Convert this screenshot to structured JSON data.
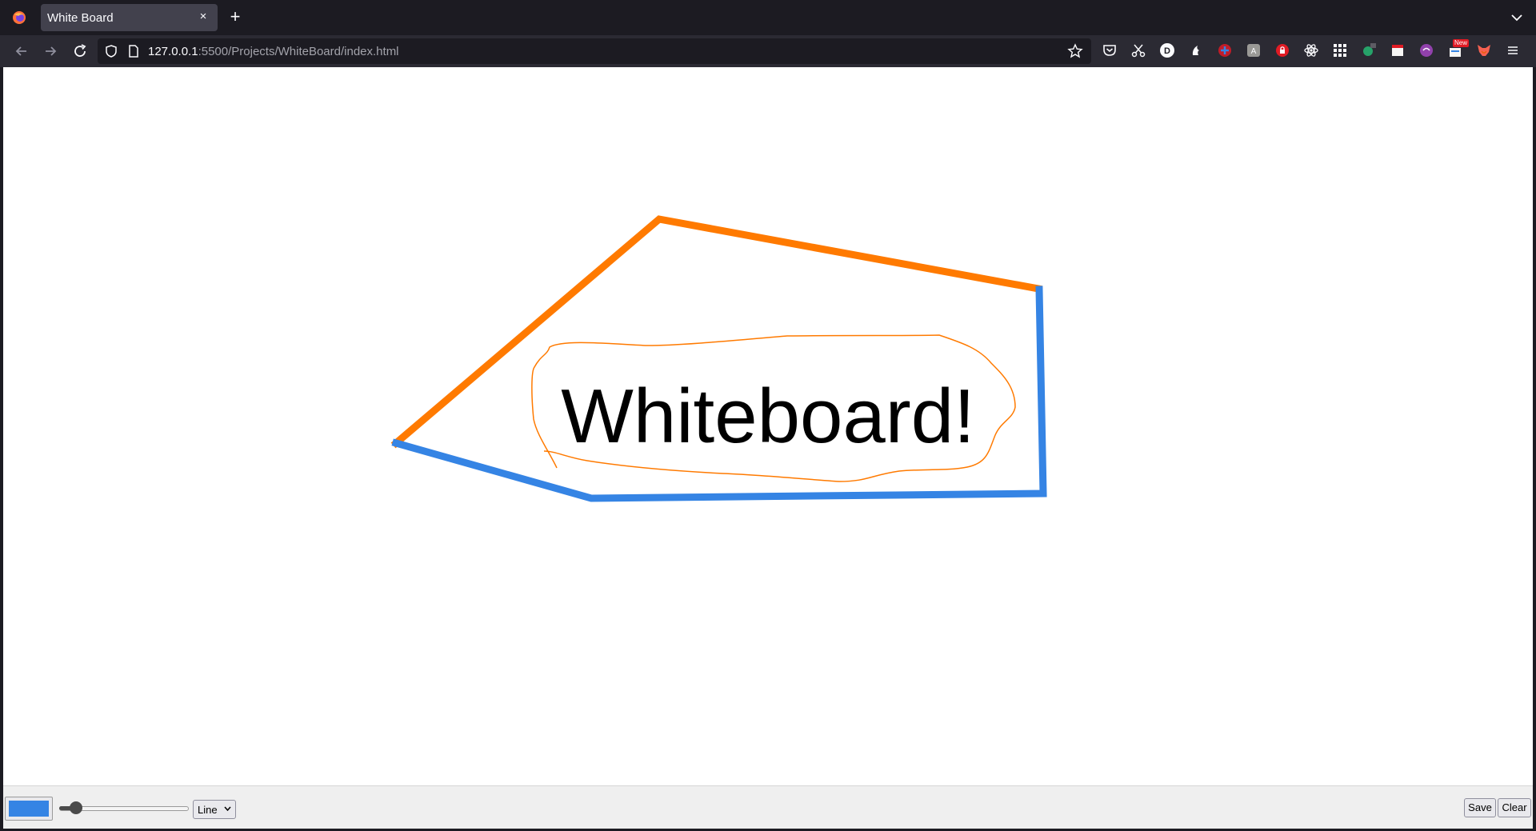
{
  "browser": {
    "tab": {
      "title": "White Board",
      "close_glyph": "×"
    },
    "new_tab_glyph": "+",
    "url": {
      "host": "127.0.0.1",
      "rest": ":5500/Projects/WhiteBoard/index.html"
    },
    "extension_badge": "New"
  },
  "whiteboard": {
    "text": "Whiteboard!",
    "stroke_colors": {
      "orange": "#ff7a00",
      "blue": "#3584e4"
    }
  },
  "toolbar": {
    "color_value": "#3584e4",
    "size_value": 5,
    "shape_selected": "Line",
    "save_label": "Save",
    "clear_label": "Clear"
  }
}
